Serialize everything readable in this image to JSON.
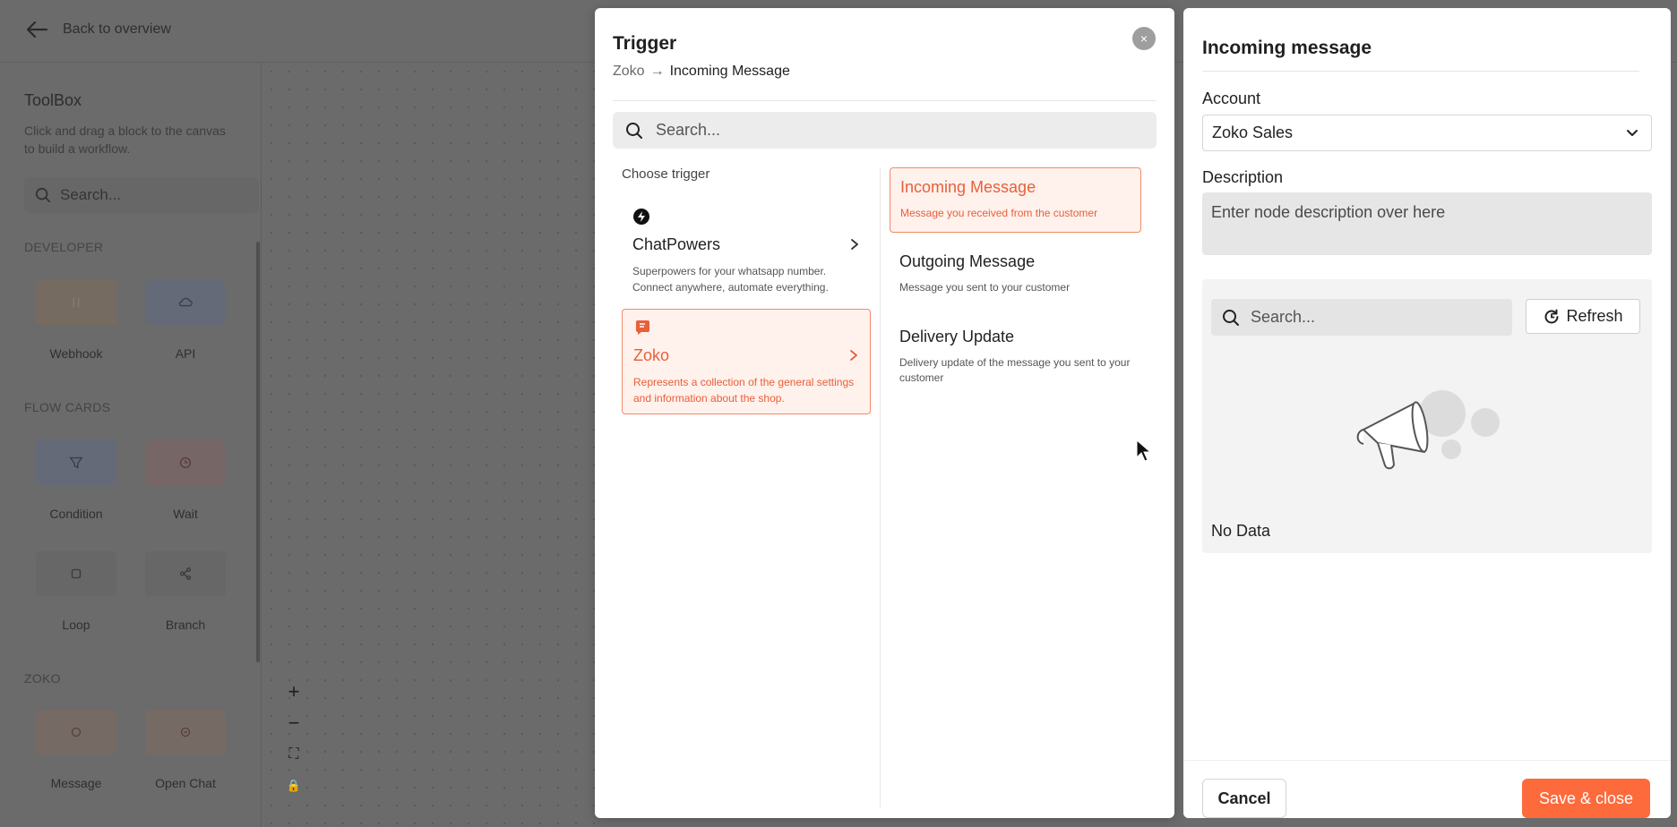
{
  "background": {
    "back_label": "Back to overview",
    "toolbox": {
      "title": "ToolBox",
      "subtitle": "Click and drag a block to the canvas to build a workflow.",
      "search_placeholder": "Search...",
      "sections": [
        {
          "title": "DEVELOPER",
          "items": [
            {
              "label": "Webhook",
              "icon": "webhook-icon",
              "color": "#766b60"
            },
            {
              "label": "API",
              "icon": "cloud-icon",
              "color": "#646a77"
            }
          ]
        },
        {
          "title": "FLOW CARDS",
          "items": [
            {
              "label": "Condition",
              "icon": "filter-icon",
              "color": "#646a77"
            },
            {
              "label": "Wait",
              "icon": "clock-icon",
              "color": "#766666"
            },
            {
              "label": "Loop",
              "icon": "loop-icon",
              "color": "#676767"
            },
            {
              "label": "Branch",
              "icon": "branch-icon",
              "color": "#676767"
            }
          ]
        },
        {
          "title": "ZOKO",
          "items": [
            {
              "label": "Message",
              "icon": "message-icon",
              "color": "#766a64"
            },
            {
              "label": "Open Chat",
              "icon": "chat-icon",
              "color": "#766a64"
            }
          ]
        }
      ]
    },
    "zoom_controls": [
      "+",
      "−",
      "⛶",
      "🔒"
    ]
  },
  "trigger_modal": {
    "title": "Trigger",
    "close_symbol": "×",
    "breadcrumb": {
      "parent": "Zoko",
      "arrow": "→",
      "current": "Incoming Message"
    },
    "search_placeholder": "Search...",
    "choose_label": "Choose trigger",
    "triggers": [
      {
        "name": "ChatPowers",
        "description": "Superpowers for your whatsapp number. Connect anywhere, automate everything.",
        "icon": "bolt-icon",
        "active": false
      },
      {
        "name": "Zoko",
        "description": "Represents a collection of the general settings and information about the shop.",
        "icon": "zoko-logo-icon",
        "active": true
      }
    ],
    "events": [
      {
        "name": "Incoming Message",
        "description": "Message you received from the customer",
        "active": true
      },
      {
        "name": "Outgoing Message",
        "description": "Message you sent to your customer",
        "active": false
      },
      {
        "name": "Delivery Update",
        "description": "Delivery update of the message you sent to your customer",
        "active": false
      }
    ]
  },
  "incoming_panel": {
    "title": "Incoming message",
    "account_label": "Account",
    "account_value": "Zoko Sales",
    "description_label": "Description",
    "description_placeholder": "Enter node description over here",
    "search_placeholder": "Search...",
    "refresh_label": "Refresh",
    "no_data_label": "No Data",
    "cancel_label": "Cancel",
    "save_label": "Save & close"
  },
  "colors": {
    "accent": "#fd6a3b",
    "accent_light": "#fff1ec",
    "accent_text": "#e8603a"
  }
}
